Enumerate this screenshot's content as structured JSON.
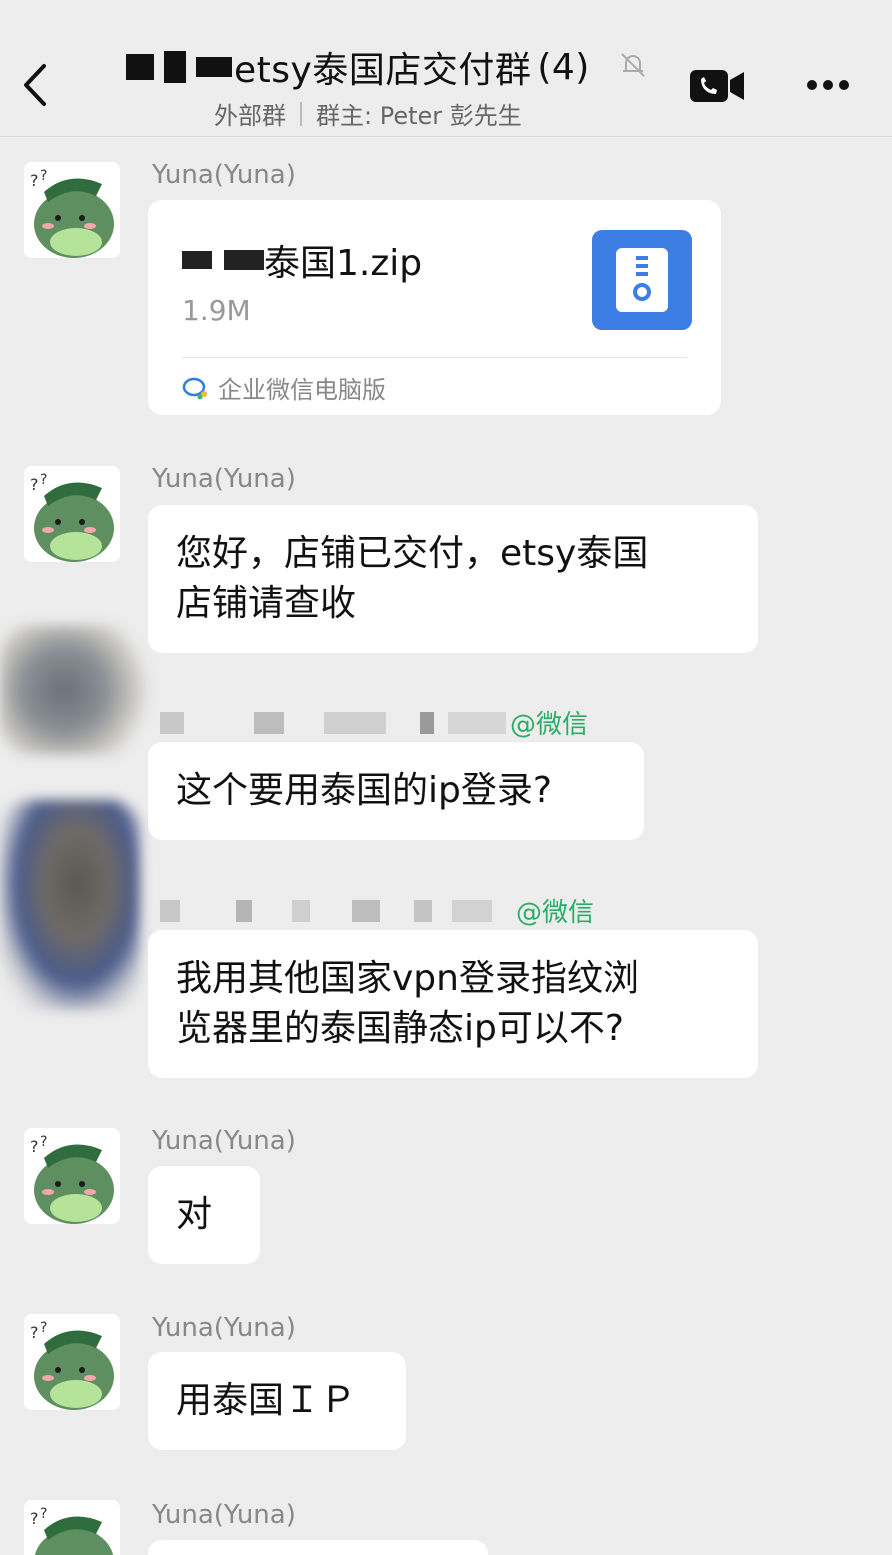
{
  "header": {
    "title": "etsy泰国店交付群",
    "member_count": "(4)",
    "group_type": "外部群",
    "owner_label": "群主: Peter 彭先生"
  },
  "messages": [
    {
      "sender": "Yuna(Yuna)",
      "file_name": "泰国1.zip",
      "file_size": "1.9M",
      "file_source": "企业微信电脑版"
    },
    {
      "sender": "Yuna(Yuna)",
      "text_line1": "您好，店铺已交付，etsy泰国",
      "text_line2": "店铺请查收"
    },
    {
      "sender_tag": "@微信",
      "text": "这个要用泰国的ip登录?"
    },
    {
      "sender_tag": "@微信",
      "text_line1": "我用其他国家vpn登录指纹浏",
      "text_line2": "览器里的泰国静态ip可以不?"
    },
    {
      "sender": "Yuna(Yuna)",
      "text": "对"
    },
    {
      "sender": "Yuna(Yuna)",
      "text": "用泰国ＩＰ"
    },
    {
      "sender": "Yuna(Yuna)"
    }
  ],
  "icons": [
    "back-icon",
    "mute-icon",
    "video-call-icon",
    "more-icon",
    "zip-file-icon",
    "wecom-icon"
  ],
  "colors": {
    "background": "#ededed",
    "bubble": "#ffffff",
    "accent_blue": "#3c7ee3",
    "wechat_green": "#2aae67"
  }
}
